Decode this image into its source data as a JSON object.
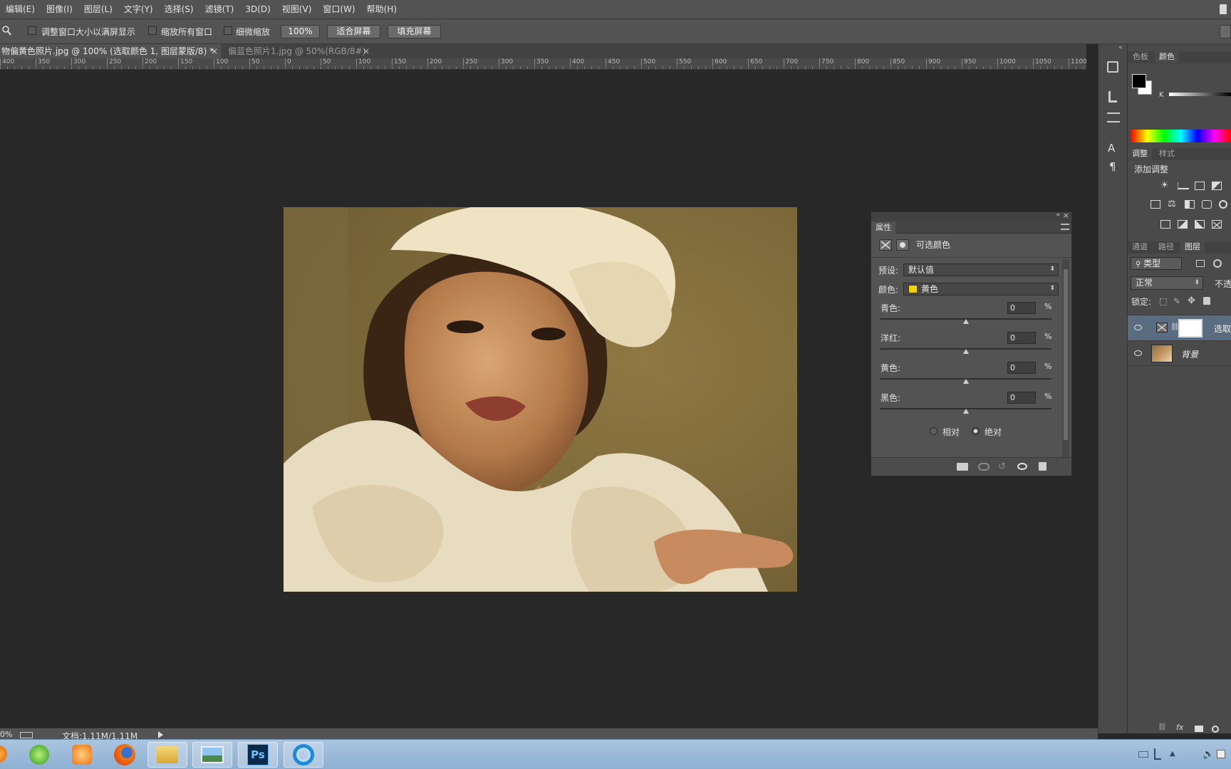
{
  "menubar": {
    "items": [
      "编辑(E)",
      "图像(I)",
      "图层(L)",
      "文字(Y)",
      "选择(S)",
      "滤镜(T)",
      "3D(D)",
      "视图(V)",
      "窗口(W)",
      "帮助(H)"
    ]
  },
  "options": {
    "resize_windows_label": "调整窗口大小以满屏显示",
    "zoom_all_label": "缩放所有窗口",
    "scrubby_zoom_label": "细微缩放",
    "zoom_value": "100%",
    "fit_screen": "适合屏幕",
    "fill_screen": "填充屏幕"
  },
  "tabs": [
    {
      "label": "物偏黄色照片.jpg @ 100% (选取颜色 1, 图层蒙版/8) *",
      "active": true
    },
    {
      "label": "偏蓝色照片1.jpg @ 50%(RGB/8#)",
      "active": false
    }
  ],
  "ruler": {
    "ticks": [
      "400",
      "350",
      "300",
      "250",
      "200",
      "150",
      "100",
      "50",
      "0",
      "50",
      "100",
      "150",
      "200",
      "250",
      "300",
      "350",
      "400",
      "450",
      "500",
      "550",
      "600",
      "650",
      "700",
      "750",
      "800",
      "850",
      "900",
      "950",
      "1000",
      "1050",
      "1100"
    ]
  },
  "properties": {
    "tab": "属性",
    "title": "可选颜色",
    "preset_label": "预设:",
    "preset_value": "默认值",
    "colors_label": "颜色:",
    "colors_value": "黄色",
    "colors_swatch": "#f2d200",
    "sliders": [
      {
        "label": "青色:",
        "value": "0",
        "unit": "%"
      },
      {
        "label": "洋红:",
        "value": "0",
        "unit": "%"
      },
      {
        "label": "黄色:",
        "value": "0",
        "unit": "%"
      },
      {
        "label": "黑色:",
        "value": "0",
        "unit": "%"
      }
    ],
    "method_relative": "相对",
    "method_absolute": "绝对",
    "method_selected": "absolute"
  },
  "color_panel": {
    "tabs": [
      "色板",
      "颜色"
    ],
    "active_tab": "颜色",
    "channel_label": "K"
  },
  "adjust_panel": {
    "tabs": [
      "调整",
      "样式"
    ],
    "active_tab": "调整",
    "add_label": "添加调整"
  },
  "layers_panel": {
    "tabs": [
      "通道",
      "路径",
      "图层"
    ],
    "active_tab": "图层",
    "filter_label": "类型",
    "blend_mode": "正常",
    "opacity_label": "不透",
    "lock_label": "锁定:",
    "layers": [
      {
        "name": "选取",
        "type": "adjustment",
        "selected": true
      },
      {
        "name": "背景",
        "type": "image",
        "selected": false
      }
    ]
  },
  "statusbar": {
    "zoom": "0%",
    "doc_info": "文档:1.11M/1.11M"
  },
  "taskbar": {
    "apps": [
      "360-browser-icon",
      "uc-browser-icon",
      "firefox-icon",
      "file-explorer-icon",
      "image-viewer-icon",
      "photoshop-icon",
      "ie-icon"
    ],
    "ps_label": "Ps"
  }
}
